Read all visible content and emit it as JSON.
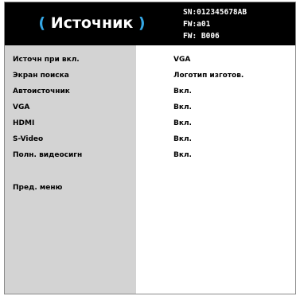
{
  "header": {
    "title_open": "(",
    "title": "Источник",
    "title_close": ")",
    "serial": "SN:012345678AB",
    "fw": "FW:a01",
    "fw_build": "FW: B006"
  },
  "settings": [
    {
      "label": "Источн при вкл.",
      "value": "VGA"
    },
    {
      "label": "Экран поиска",
      "value": "Логотип изготов."
    },
    {
      "label": "Автоисточник",
      "value": "Вкл."
    },
    {
      "label": "VGA",
      "value": "Вкл."
    },
    {
      "label": "HDMI",
      "value": "Вкл."
    },
    {
      "label": "S-Video",
      "value": "Вкл."
    },
    {
      "label": "Полн. видеосигн",
      "value": "Вкл."
    }
  ],
  "back": {
    "label": "Пред. меню"
  },
  "colors": {
    "header_bg": "#000000",
    "accent_paren": "#35a8e6",
    "label_col_bg": "#d3d3d3",
    "value_col_bg": "#ffffff"
  }
}
